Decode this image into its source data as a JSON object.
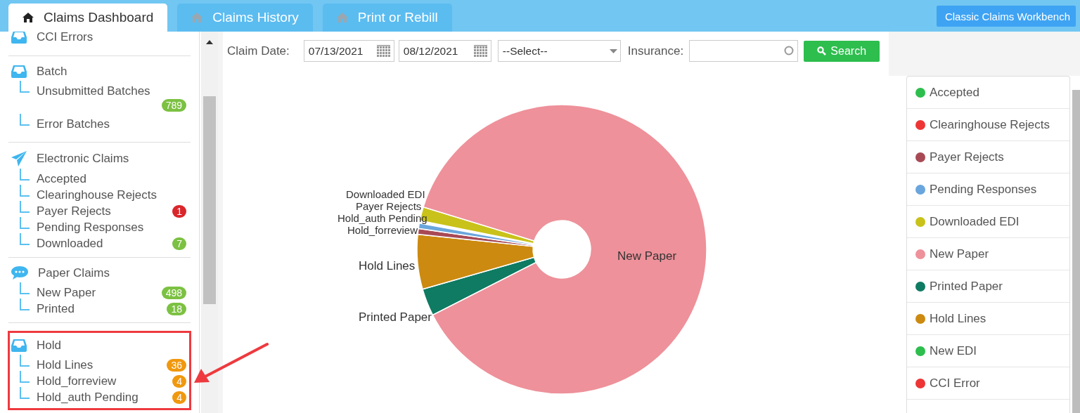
{
  "tabs": [
    {
      "label": "Claims Dashboard",
      "selected": true
    },
    {
      "label": "Claims History",
      "selected": false
    },
    {
      "label": "Print or Rebill",
      "selected": false
    }
  ],
  "header_button": "Classic Claims Workbench",
  "sidebar": {
    "sections": [
      {
        "title": "CCI Errors",
        "kind": "tray",
        "highlighted": false
      },
      {
        "title": "Batch",
        "kind": "tray",
        "highlighted": false,
        "items": [
          {
            "label": "Unsubmitted Batches",
            "badge": "789",
            "color": "#7cc142"
          },
          {
            "label": "Error Batches"
          }
        ]
      },
      {
        "title": "Electronic Claims",
        "kind": "plane",
        "highlighted": false,
        "items": [
          {
            "label": "Accepted"
          },
          {
            "label": "Clearinghouse Rejects"
          },
          {
            "label": "Payer Rejects",
            "badge": "1",
            "color": "#d9262b"
          },
          {
            "label": "Pending Responses"
          },
          {
            "label": "Downloaded",
            "badge": "7",
            "color": "#7cc142"
          }
        ]
      },
      {
        "title": "Paper Claims",
        "kind": "chat",
        "highlighted": false,
        "items": [
          {
            "label": "New Paper",
            "badge": "498",
            "color": "#7cc142"
          },
          {
            "label": "Printed",
            "badge": "18",
            "color": "#7cc142"
          }
        ]
      },
      {
        "title": "Hold",
        "kind": "tray",
        "highlighted": true,
        "items": [
          {
            "label": "Hold Lines",
            "badge": "36",
            "color": "#f0980e"
          },
          {
            "label": "Hold_forreview",
            "badge": "4",
            "color": "#f0980e"
          },
          {
            "label": "Hold_auth Pending",
            "badge": "4",
            "color": "#f0980e"
          }
        ]
      }
    ]
  },
  "filter": {
    "date_label": "Claim Date:",
    "date_from": "07/13/2021",
    "date_to": "08/12/2021",
    "select": "--Select--",
    "insurance_label": "Insurance:",
    "search_button": "Search"
  },
  "pie_labels": [
    "Downloaded EDI",
    "Payer Rejects",
    "Hold_auth Pending",
    "Hold_forreview",
    "Hold Lines",
    "Printed Paper",
    "New Paper"
  ],
  "legend": [
    {
      "label": "Accepted",
      "color": "#2dbe4e"
    },
    {
      "label": "Clearinghouse Rejects",
      "color": "#ee3535"
    },
    {
      "label": "Payer Rejects",
      "color": "#a84a55"
    },
    {
      "label": "Pending Responses",
      "color": "#6aa6dd"
    },
    {
      "label": "Downloaded EDI",
      "color": "#c9c21a"
    },
    {
      "label": "New Paper",
      "color": "#ee919a"
    },
    {
      "label": "Printed Paper",
      "color": "#0e7b62"
    },
    {
      "label": "Hold Lines",
      "color": "#cc8a10"
    },
    {
      "label": "New EDI",
      "color": "#2dbe4e"
    },
    {
      "label": "CCI Error",
      "color": "#ee3535"
    }
  ]
}
